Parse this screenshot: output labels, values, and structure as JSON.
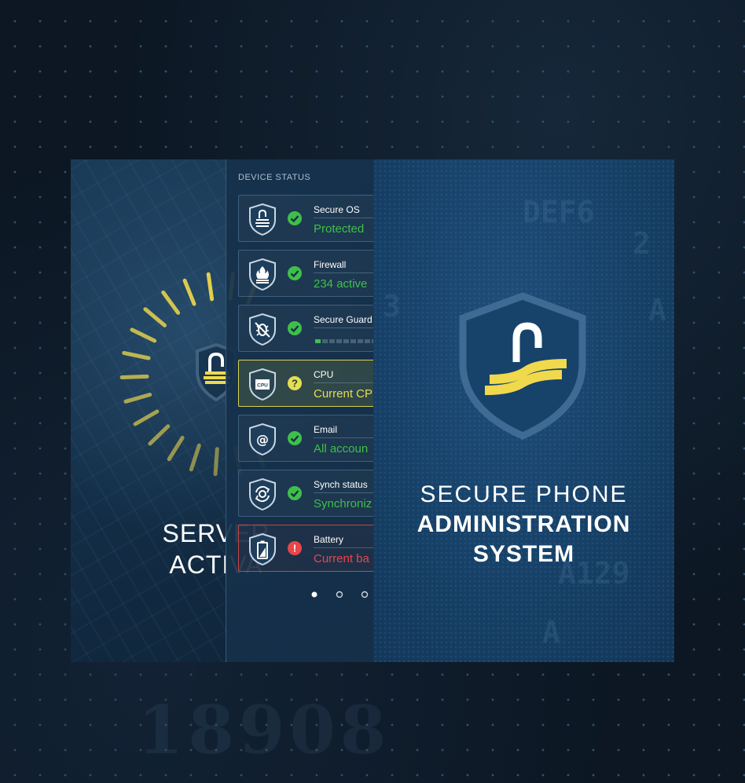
{
  "brand": {
    "accent_yellow": "#f0d94c",
    "ok_green": "#3fbf4a",
    "warn_yellow": "#e5dd53",
    "error_red": "#e8464a",
    "panel_blue": "#16304a"
  },
  "left_screen": {
    "title_line1": "SERVER",
    "title_line2": "ACTIVA",
    "icon": "shield-lock-icon"
  },
  "device_status": {
    "header": "DEVICE STATUS",
    "items": [
      {
        "label": "Secure OS",
        "value": "Protected",
        "status": "ok",
        "icon": "lock-shield-icon"
      },
      {
        "label": "Firewall",
        "value": "234 active",
        "status": "ok",
        "icon": "firewall-shield-icon"
      },
      {
        "label": "Secure Guard",
        "value": "",
        "status": "ok",
        "icon": "bug-shield-icon",
        "progress": 0.12
      },
      {
        "label": "CPU",
        "value": "Current CP",
        "status": "warning",
        "icon": "cpu-shield-icon",
        "chip_text": "CPU"
      },
      {
        "label": "Email",
        "value": "All accoun",
        "status": "ok",
        "icon": "email-shield-icon",
        "glyph": "@"
      },
      {
        "label": "Synch status",
        "value": "Synchroniz",
        "status": "ok",
        "icon": "sync-shield-icon"
      },
      {
        "label": "Battery",
        "value": "Current ba",
        "status": "error",
        "icon": "battery-shield-icon",
        "badge_glyph": "!"
      }
    ],
    "pager": {
      "count": 3,
      "active": 0
    }
  },
  "right_screen": {
    "title_line1": "SECURE PHONE",
    "title_line2": "ADMINISTRATION",
    "title_line3": "SYSTEM",
    "icon": "shield-lock-icon"
  },
  "background": {
    "digits": "18908"
  }
}
